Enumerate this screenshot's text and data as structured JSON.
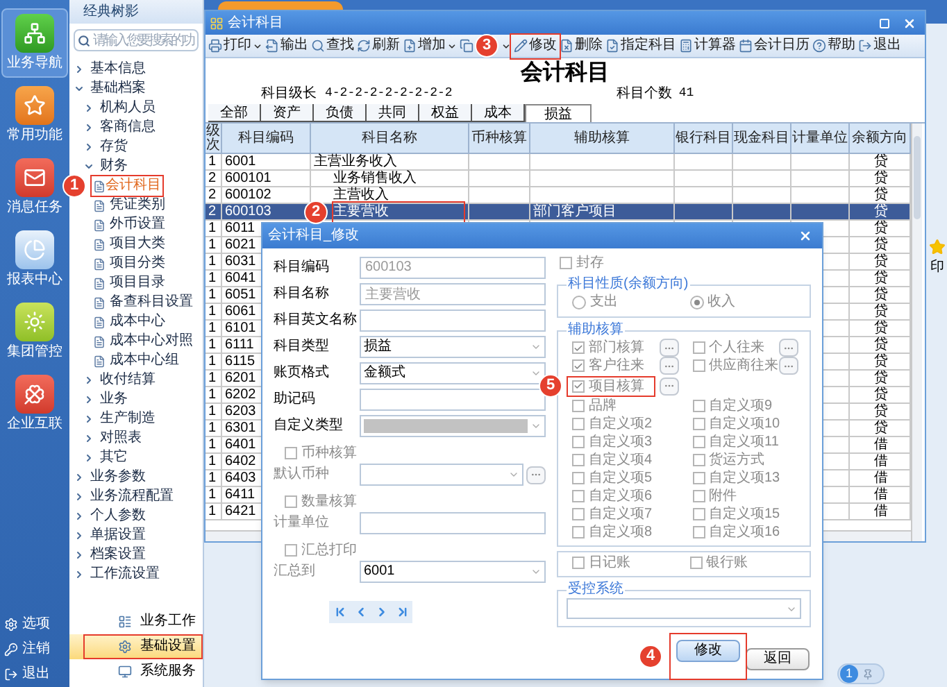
{
  "nav": {
    "items": [
      {
        "label": "业务导航",
        "selected": true
      },
      {
        "label": "常用功能",
        "selected": false
      },
      {
        "label": "消息任务",
        "selected": false
      },
      {
        "label": "报表中心",
        "selected": false
      },
      {
        "label": "集团管控",
        "selected": false
      },
      {
        "label": "企业互联",
        "selected": false
      }
    ],
    "footer": [
      {
        "label": "选项"
      },
      {
        "label": "注销"
      },
      {
        "label": "退出"
      }
    ]
  },
  "tree": {
    "title": "经典树影",
    "search": {
      "placeholder": "请输入您要搜索的功"
    },
    "items": [
      {
        "label": "基本信息",
        "expanded": false
      },
      {
        "label": "基础档案",
        "expanded": true,
        "children": [
          {
            "label": "机构人员",
            "expanded": false
          },
          {
            "label": "客商信息",
            "expanded": false
          },
          {
            "label": "存货",
            "expanded": false
          },
          {
            "label": "财务",
            "expanded": true,
            "children": [
              {
                "label": "会计科目",
                "selected": true,
                "callout": "1"
              },
              {
                "label": "凭证类别",
                "selected": false
              },
              {
                "label": "外币设置",
                "selected": false
              },
              {
                "label": "项目大类",
                "selected": false
              },
              {
                "label": "项目分类",
                "selected": false
              },
              {
                "label": "项目目录",
                "selected": false
              },
              {
                "label": "备查科目设置",
                "selected": false
              },
              {
                "label": "成本中心",
                "selected": false
              },
              {
                "label": "成本中心对照",
                "selected": false
              },
              {
                "label": "成本中心组",
                "selected": false
              }
            ]
          },
          {
            "label": "收付结算",
            "expanded": false
          },
          {
            "label": "业务",
            "expanded": false
          },
          {
            "label": "生产制造",
            "expanded": false
          },
          {
            "label": "对照表",
            "expanded": false
          },
          {
            "label": "其它",
            "expanded": false
          }
        ]
      },
      {
        "label": "业务参数",
        "expanded": false
      },
      {
        "label": "业务流程配置",
        "expanded": false
      },
      {
        "label": "个人参数",
        "expanded": false
      },
      {
        "label": "单据设置",
        "expanded": false
      },
      {
        "label": "档案设置",
        "expanded": false
      },
      {
        "label": "工作流设置",
        "expanded": false
      }
    ],
    "modules": [
      {
        "label": "业务工作",
        "selected": false,
        "highlighted": false
      },
      {
        "label": "基础设置",
        "selected": true,
        "highlighted": true
      },
      {
        "label": "系统服务",
        "selected": false,
        "highlighted": false
      }
    ]
  },
  "desktop": {
    "shortcut_label": "印",
    "page_indicator": "1"
  },
  "account_window": {
    "title": "会计科目",
    "toolbar": [
      {
        "label": "打印",
        "dropdown": true
      },
      {
        "label": "输出",
        "dropdown": false
      },
      {
        "label": "查找",
        "dropdown": false
      },
      {
        "label": "刷新",
        "dropdown": false
      },
      {
        "label": "增加",
        "dropdown": true
      },
      {
        "dropdown": true
      },
      {
        "label": "修改",
        "dropdown": false,
        "callout": "3"
      },
      {
        "label": "删除",
        "dropdown": false
      },
      {
        "label": "指定科目",
        "dropdown": false
      },
      {
        "label": "计算器",
        "dropdown": false
      },
      {
        "label": "会计日历",
        "dropdown": false
      },
      {
        "label": "帮助",
        "dropdown": false
      },
      {
        "label": "退出",
        "dropdown": false
      }
    ],
    "heading": "会计科目",
    "level_label": "科目级长",
    "level_value": "4-2-2-2-2-2-2-2-2",
    "count_label": "科目个数",
    "count_value": "41",
    "tabs": [
      {
        "label": "全部",
        "selected": false
      },
      {
        "label": "资产",
        "selected": false
      },
      {
        "label": "负债",
        "selected": false
      },
      {
        "label": "共同",
        "selected": false
      },
      {
        "label": "权益",
        "selected": false
      },
      {
        "label": "成本",
        "selected": false
      },
      {
        "label": "损益",
        "selected": true
      }
    ],
    "table": {
      "columns": [
        "级次",
        "科目编码",
        "科目名称",
        "币种核算",
        "辅助核算",
        "银行科目",
        "现金科目",
        "计量单位",
        "余额方向"
      ],
      "rows": [
        {
          "grade": "1",
          "code": "6001",
          "name": "主营业务收入",
          "direction": "贷",
          "selected": false,
          "children": [
            {
              "grade": "2",
              "code": "600101",
              "name": "业务销售收入",
              "direction": "贷",
              "selected": false
            },
            {
              "grade": "2",
              "code": "600102",
              "name": "主营收入",
              "direction": "贷",
              "selected": false
            },
            {
              "grade": "2",
              "code": "600103",
              "name": "主要营收",
              "auxiliary": "部门客户项目",
              "direction": "贷",
              "selected": true,
              "callout": "2"
            }
          ]
        },
        {
          "grade": "1",
          "code": "6011",
          "direction": "贷",
          "selected": false
        },
        {
          "grade": "1",
          "code": "6021",
          "direction": "贷",
          "selected": false
        },
        {
          "grade": "1",
          "code": "6031",
          "direction": "贷",
          "selected": false
        },
        {
          "grade": "1",
          "code": "6041",
          "direction": "贷",
          "selected": false
        },
        {
          "grade": "1",
          "code": "6051",
          "direction": "贷",
          "selected": false
        },
        {
          "grade": "1",
          "code": "6061",
          "direction": "贷",
          "selected": false
        },
        {
          "grade": "1",
          "code": "6101",
          "direction": "贷",
          "selected": false
        },
        {
          "grade": "1",
          "code": "6111",
          "direction": "贷",
          "selected": false
        },
        {
          "grade": "1",
          "code": "6115",
          "direction": "贷",
          "selected": false
        },
        {
          "grade": "1",
          "code": "6201",
          "direction": "贷",
          "selected": false
        },
        {
          "grade": "1",
          "code": "6202",
          "direction": "贷",
          "selected": false
        },
        {
          "grade": "1",
          "code": "6203",
          "direction": "贷",
          "selected": false
        },
        {
          "grade": "1",
          "code": "6301",
          "direction": "贷",
          "selected": false
        },
        {
          "grade": "1",
          "code": "6401",
          "direction": "借",
          "selected": false
        },
        {
          "grade": "1",
          "code": "6402",
          "direction": "借",
          "selected": false
        },
        {
          "grade": "1",
          "code": "6403",
          "direction": "借",
          "selected": false
        },
        {
          "grade": "1",
          "code": "6411",
          "direction": "借",
          "selected": false
        },
        {
          "grade": "1",
          "code": "6421",
          "direction": "借",
          "selected": false
        }
      ]
    }
  },
  "dialog": {
    "title": "会计科目_修改",
    "fields": [
      {
        "label": "科目编码",
        "kind": "text",
        "value": "600103",
        "disabled": true
      },
      {
        "label": "科目名称",
        "kind": "text",
        "value": "主要营收",
        "disabled": true
      },
      {
        "label": "科目英文名称",
        "kind": "text"
      },
      {
        "label": "科目类型",
        "kind": "select",
        "value": "损益",
        "disabled": false
      },
      {
        "label": "账页格式",
        "kind": "select",
        "value": "金额式",
        "disabled": false
      },
      {
        "label": "助记码",
        "kind": "text"
      },
      {
        "label": "自定义类型",
        "kind": "select",
        "disabled": true
      }
    ],
    "currency": {
      "checkbox": {
        "label": "币种核算",
        "checked": false
      },
      "field_label": "默认币种"
    },
    "quantity": {
      "checkbox": {
        "label": "数量核算",
        "checked": false
      },
      "field_label": "计量单位"
    },
    "summary": {
      "checkbox": {
        "label": "汇总打印",
        "checked": false
      },
      "field_label": "汇总到",
      "value": "6001"
    },
    "sealed": {
      "label": "封存",
      "checked": false
    },
    "nature": {
      "title": "科目性质(余额方向)",
      "options": [
        {
          "label": "支出",
          "selected": false
        },
        {
          "label": "收入",
          "selected": true
        }
      ]
    },
    "auxiliary": {
      "title": "辅助核算",
      "rows": [
        {
          "items": [
            {
              "label": "部门核算",
              "checked": true,
              "picker": true
            },
            {
              "label": "个人往来",
              "checked": false,
              "picker": true
            }
          ]
        },
        {
          "items": [
            {
              "label": "客户往来",
              "checked": true,
              "picker": true
            },
            {
              "label": "供应商往来",
              "checked": false,
              "picker": true
            }
          ]
        },
        {
          "items": [
            {
              "label": "项目核算",
              "checked": true,
              "picker": true,
              "callout": "5"
            }
          ]
        },
        {
          "items": [
            {
              "label": "品牌",
              "checked": false,
              "picker": false
            },
            {
              "label": "自定义项9",
              "checked": false,
              "picker": false
            }
          ]
        },
        {
          "items": [
            {
              "label": "自定义项2",
              "checked": false,
              "picker": false
            },
            {
              "label": "自定义项10",
              "checked": false,
              "picker": false
            }
          ]
        },
        {
          "items": [
            {
              "label": "自定义项3",
              "checked": false,
              "picker": false
            },
            {
              "label": "自定义项11",
              "checked": false,
              "picker": false
            }
          ]
        },
        {
          "items": [
            {
              "label": "自定义项4",
              "checked": false,
              "picker": false
            },
            {
              "label": "货运方式",
              "checked": false,
              "picker": false
            }
          ]
        },
        {
          "items": [
            {
              "label": "自定义项5",
              "checked": false,
              "picker": false
            },
            {
              "label": "自定义项13",
              "checked": false,
              "picker": false
            }
          ]
        },
        {
          "items": [
            {
              "label": "自定义项6",
              "checked": false,
              "picker": false
            },
            {
              "label": "附件",
              "checked": false,
              "picker": false
            }
          ]
        },
        {
          "items": [
            {
              "label": "自定义项7",
              "checked": false,
              "picker": false
            },
            {
              "label": "自定义项15",
              "checked": false,
              "picker": false
            }
          ]
        },
        {
          "items": [
            {
              "label": "自定义项8",
              "checked": false,
              "picker": false
            },
            {
              "label": "自定义项16",
              "checked": false,
              "picker": false
            }
          ]
        }
      ]
    },
    "ledgers": [
      {
        "label": "日记账",
        "checked": false
      },
      {
        "label": "银行账",
        "checked": false
      }
    ],
    "controlled_system": {
      "title": "受控系统"
    },
    "buttons": [
      {
        "label": "修改",
        "primary": true,
        "callout": "4"
      },
      {
        "label": "返回",
        "primary": false
      }
    ]
  }
}
